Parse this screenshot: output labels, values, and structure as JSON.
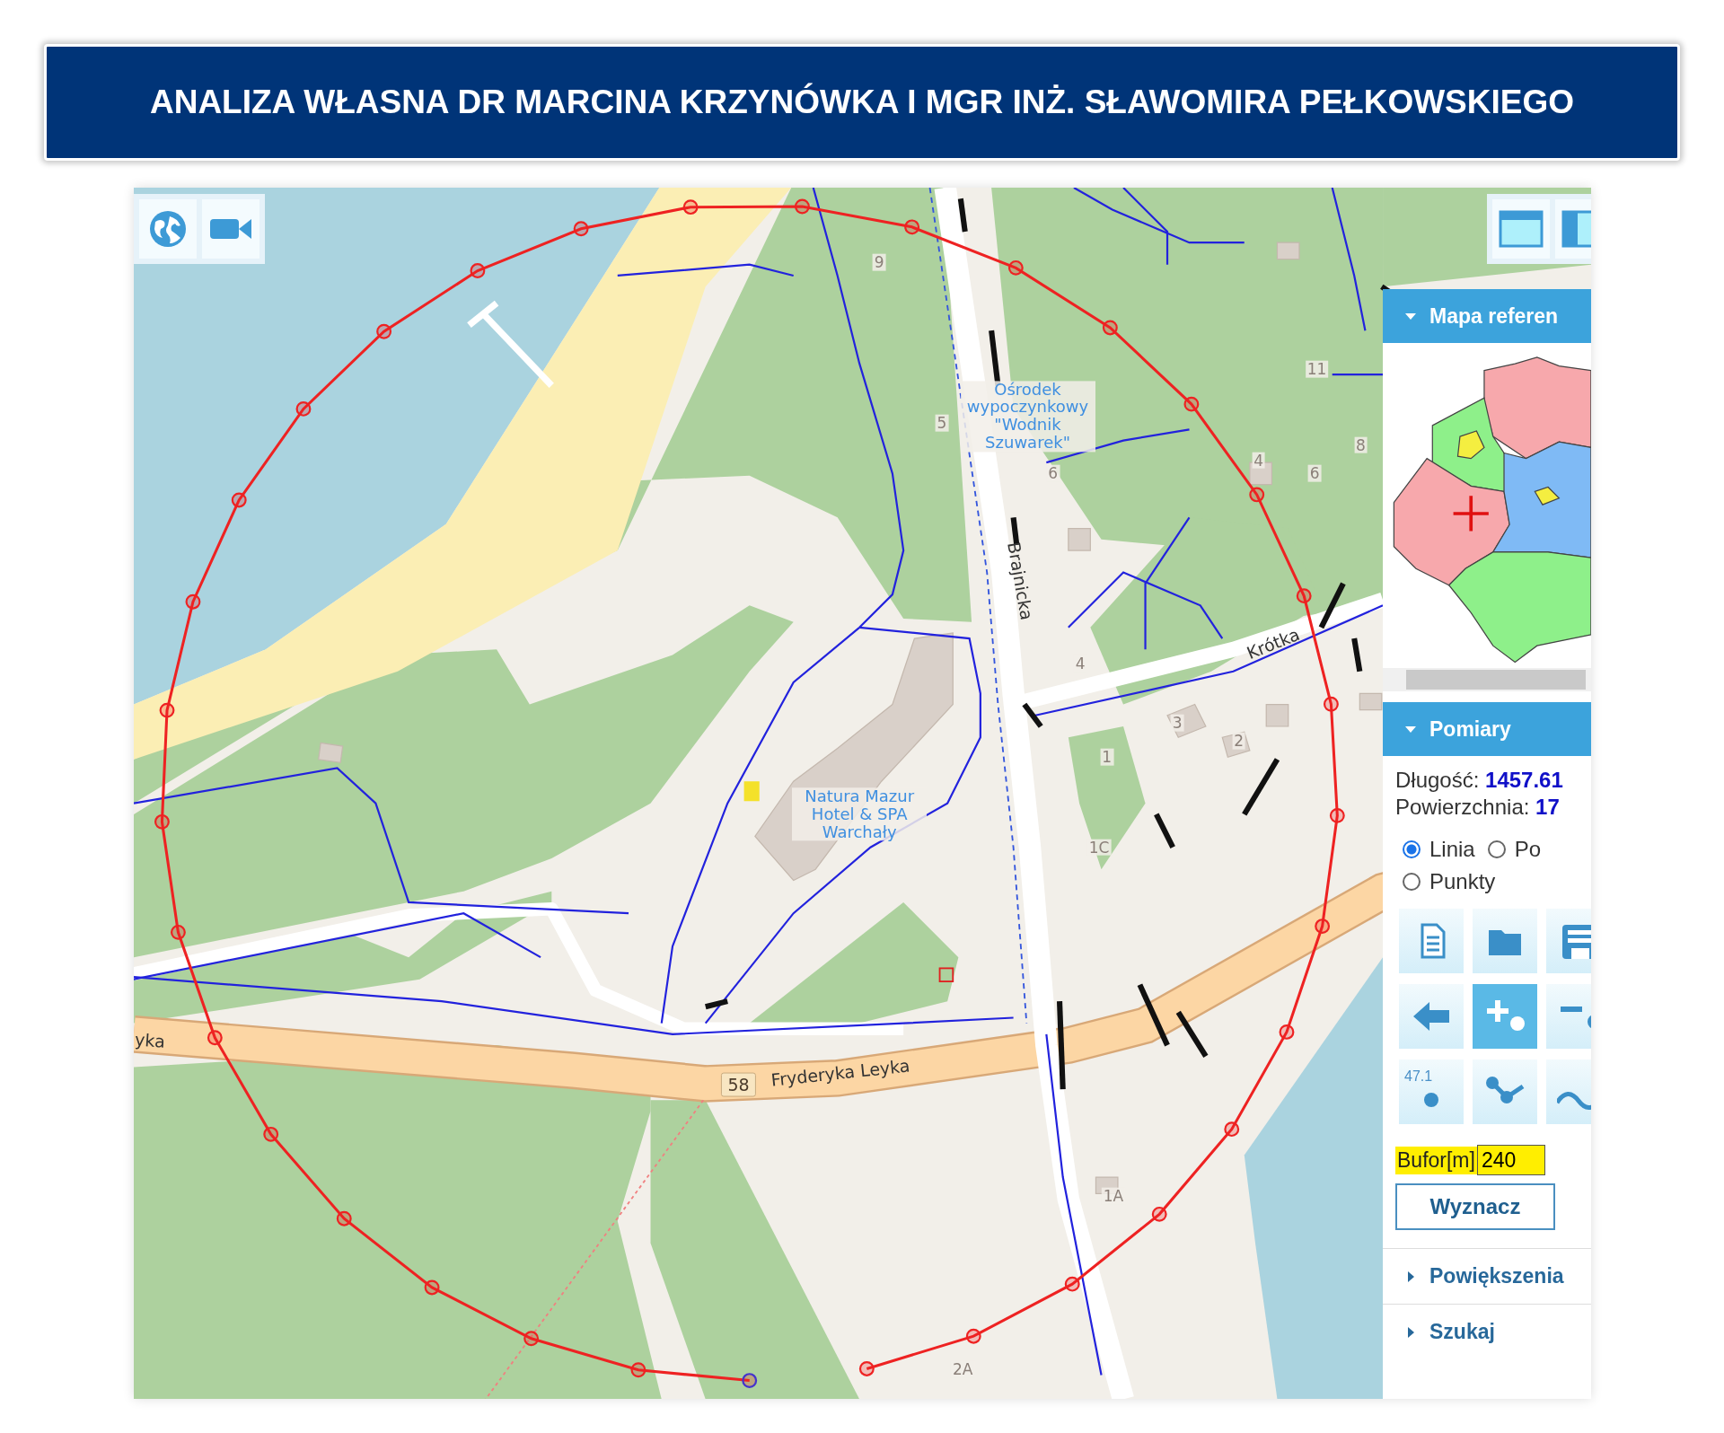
{
  "banner": {
    "title": "ANALIZA WŁASNA DR MARCINA KRZYNÓWKA I MGR INŻ. SŁAWOMIRA PEŁKOWSKIEGO"
  },
  "map": {
    "labels": [
      {
        "kind": "house",
        "text": "9"
      },
      {
        "kind": "house",
        "text": "5"
      },
      {
        "kind": "poi",
        "text": "Ośrodek wypoczynkowy \"Wodnik Szuwarek\""
      },
      {
        "kind": "house",
        "text": "6"
      },
      {
        "kind": "house",
        "text": "4"
      },
      {
        "kind": "house",
        "text": "6"
      },
      {
        "kind": "house",
        "text": "8"
      },
      {
        "kind": "house",
        "text": "11"
      },
      {
        "kind": "street",
        "text": "Brajnicka"
      },
      {
        "kind": "street",
        "text": "Krótka"
      },
      {
        "kind": "house",
        "text": "4"
      },
      {
        "kind": "house",
        "text": "3"
      },
      {
        "kind": "house",
        "text": "2"
      },
      {
        "kind": "house",
        "text": "1"
      },
      {
        "kind": "poi",
        "text": "Natura Mazur Hotel & SPA Warchały"
      },
      {
        "kind": "house",
        "text": "1C"
      },
      {
        "kind": "street",
        "text": "yka"
      },
      {
        "kind": "shield",
        "text": "58"
      },
      {
        "kind": "street",
        "text": "Fryderyka Leyka"
      },
      {
        "kind": "house",
        "text": "1A"
      },
      {
        "kind": "house",
        "text": "2A"
      }
    ]
  },
  "panel": {
    "sections": [
      {
        "kind": "reference-map",
        "title": "Mapa referen",
        "expanded": true
      },
      {
        "kind": "measure",
        "title": "Pomiary",
        "expanded": true
      },
      {
        "title": "Powiększenia",
        "expanded": false
      },
      {
        "title": "Szukaj",
        "expanded": false
      }
    ],
    "measure": {
      "length": {
        "label": "Długość:",
        "value": "1457.61"
      },
      "area": {
        "label": "Powierzchnia:",
        "value": "17"
      },
      "modes": [
        {
          "label": "Linia",
          "selected": true
        },
        {
          "label": "Po",
          "selected": false
        },
        {
          "label": "Punkty",
          "selected": false
        }
      ],
      "tools": [
        {
          "kind": "document",
          "selected": false
        },
        {
          "kind": "folder",
          "selected": false
        },
        {
          "kind": "save",
          "selected": false
        },
        {
          "kind": "back",
          "selected": false
        },
        {
          "kind": "add-point",
          "selected": true
        },
        {
          "kind": "remove-point",
          "selected": false
        },
        {
          "kind": "point-label",
          "text": "47.1",
          "selected": false
        },
        {
          "kind": "polyline",
          "selected": false
        },
        {
          "kind": "curve",
          "selected": false
        }
      ],
      "buffer": {
        "label": "Bufor[m]",
        "value": "240"
      },
      "button": "Wyznacz"
    }
  }
}
